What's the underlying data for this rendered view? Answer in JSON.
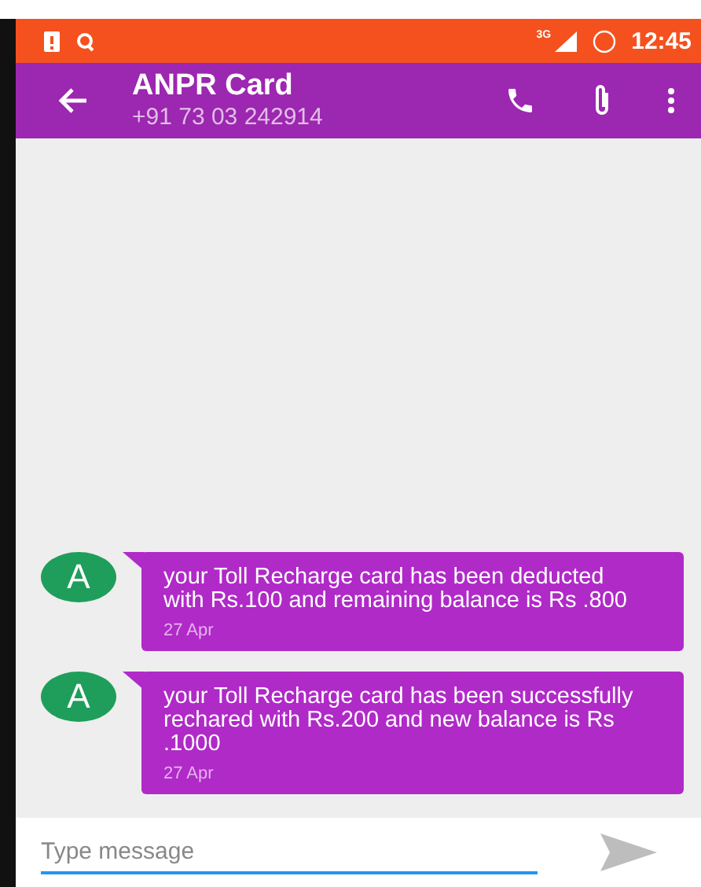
{
  "status_bar": {
    "network": "3G",
    "time": "12:45"
  },
  "toolbar": {
    "title": "ANPR Card",
    "subtitle": "+91 73 03 242914"
  },
  "messages": [
    {
      "avatar": "A",
      "text": "your Toll Recharge card has been deducted with Rs.100 and remaining balance is Rs .800",
      "date": "27 Apr"
    },
    {
      "avatar": "A",
      "text": "your Toll Recharge card has been successfully rechared with Rs.200 and new balance is Rs .1000",
      "date": "27 Apr"
    }
  ],
  "composer": {
    "placeholder": "Type message"
  }
}
